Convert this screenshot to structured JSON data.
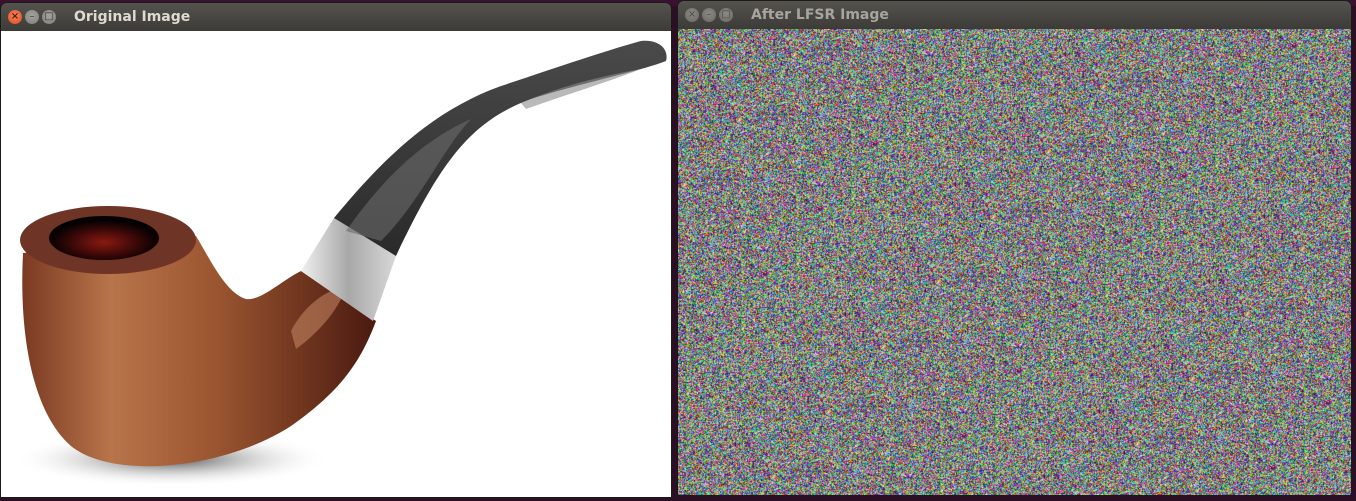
{
  "windows": {
    "left": {
      "title": "Original Image",
      "buttons": {
        "close": "×",
        "minimize": "–",
        "maximize": "□"
      }
    },
    "right": {
      "title": "After LFSR Image",
      "buttons": {
        "close": "×",
        "minimize": "–",
        "maximize": "□"
      }
    }
  },
  "colors": {
    "title_active": "#dfdbd2",
    "title_inactive": "#a8a59e",
    "close_button": "#e0461a",
    "desktop": "#2c0f24"
  },
  "icons": [
    "close-icon",
    "minimize-icon",
    "maximize-icon"
  ]
}
